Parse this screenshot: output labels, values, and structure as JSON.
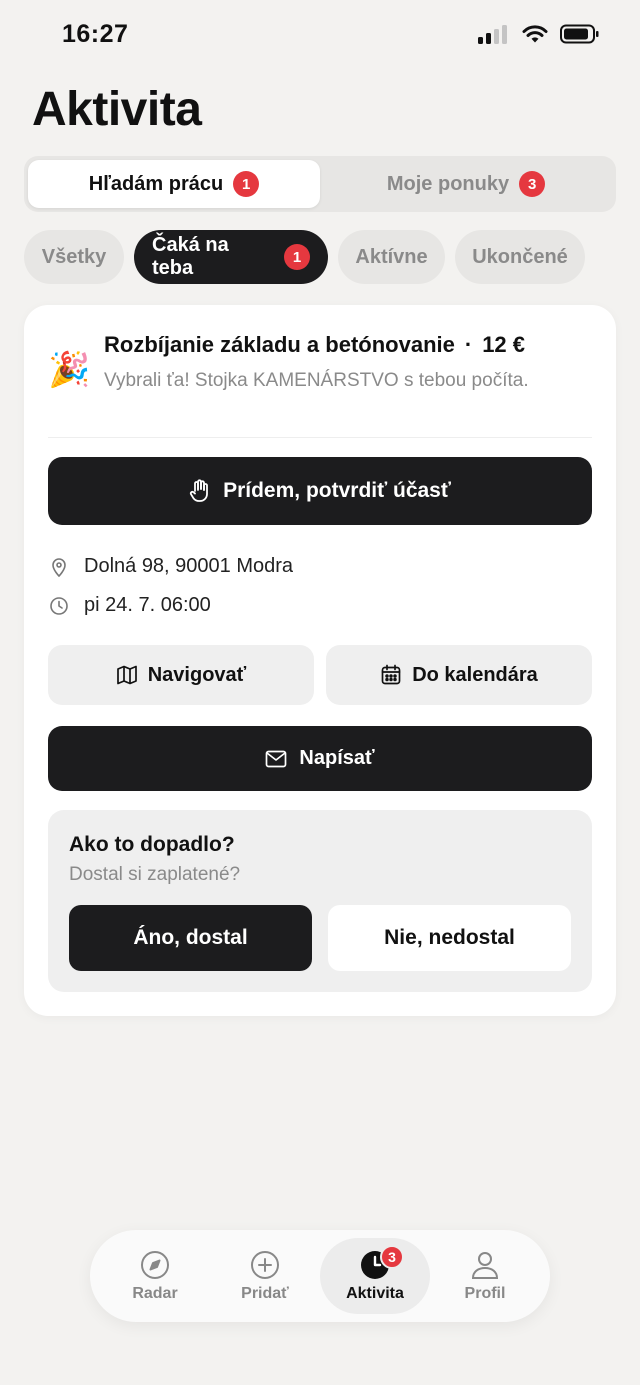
{
  "status_bar": {
    "time": "16:27"
  },
  "page": {
    "title": "Aktivita"
  },
  "segments": [
    {
      "label": "Hľadám prácu",
      "badge": "1"
    },
    {
      "label": "Moje ponuky",
      "badge": "3"
    }
  ],
  "filters": [
    {
      "label": "Všetky"
    },
    {
      "label": "Čaká na teba",
      "badge": "1"
    },
    {
      "label": "Aktívne"
    },
    {
      "label": "Ukončené"
    }
  ],
  "job": {
    "emoji": "🎉",
    "title": "Rozbíjanie základu a betónovanie",
    "separator": "·",
    "price": "12 €",
    "subtitle": "Vybrali ťa! Stojka KAMENÁRSTVO s tebou počíta.",
    "confirm_label": "Prídem, potvrdiť účasť",
    "address": "Dolná 98, 90001 Modra",
    "datetime": "pi 24. 7. 06:00",
    "navigate_label": "Navigovať",
    "calendar_label": "Do kalendára",
    "write_label": "Napísať"
  },
  "feedback": {
    "title": "Ako to dopadlo?",
    "subtitle": "Dostal si zaplatené?",
    "yes_label": "Áno, dostal",
    "no_label": "Nie, nedostal"
  },
  "tabbar": {
    "items": [
      {
        "label": "Radar",
        "icon": "compass-icon"
      },
      {
        "label": "Pridať",
        "icon": "plus-circle-icon"
      },
      {
        "label": "Aktivita",
        "icon": "clock-icon",
        "badge": "3"
      },
      {
        "label": "Profil",
        "icon": "person-icon"
      }
    ]
  },
  "colors": {
    "accent_dark": "#1c1c1e",
    "badge_red": "#e5383f",
    "background": "#f3f2f0"
  }
}
